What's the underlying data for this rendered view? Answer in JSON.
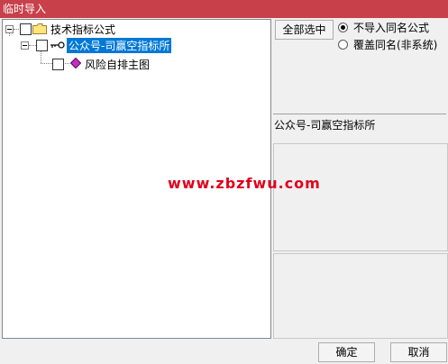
{
  "window": {
    "title": "临时导入"
  },
  "tree": {
    "root": {
      "label": "技术指标公式"
    },
    "group": {
      "label": "公众号-司赢空指标所"
    },
    "item": {
      "label": "风险自排主图"
    }
  },
  "options": {
    "select_all": "全部选中",
    "radio_skip": "不导入同名公式",
    "radio_overwrite": "覆盖同名(非系统)",
    "selected": "radio_skip"
  },
  "detail": {
    "name": "公众号-司赢空指标所"
  },
  "watermark": "www.zbzfwu.com",
  "footer": {
    "ok": "确定",
    "cancel": "取消"
  },
  "colors": {
    "titlebar": "#c8404a",
    "selection": "#0078d7",
    "watermark": "#e0001c"
  }
}
